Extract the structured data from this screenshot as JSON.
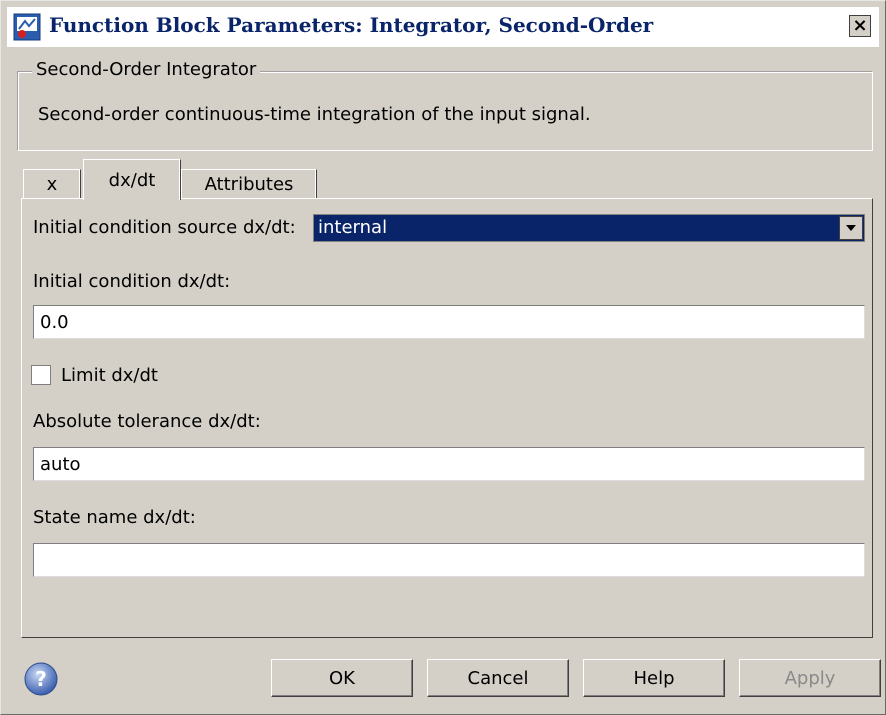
{
  "window": {
    "title": "Function Block Parameters: Integrator, Second-Order",
    "close_label": "×"
  },
  "group": {
    "legend": "Second-Order Integrator",
    "description": "Second-order continuous-time integration of the input signal."
  },
  "tabs": [
    {
      "label": "x",
      "active": false
    },
    {
      "label": "dx/dt",
      "active": true
    },
    {
      "label": "Attributes",
      "active": false
    }
  ],
  "fields": {
    "ic_source_label": "Initial condition source dx/dt:",
    "ic_source_value": "internal",
    "ic_label": "Initial condition dx/dt:",
    "ic_value": "0.0",
    "limit_label": "Limit dx/dt",
    "limit_checked": false,
    "abs_tol_label": "Absolute tolerance dx/dt:",
    "abs_tol_value": "auto",
    "state_name_label": "State name dx/dt:",
    "state_name_value": ""
  },
  "buttons": {
    "ok": "OK",
    "cancel": "Cancel",
    "help": "Help",
    "apply": "Apply"
  },
  "colors": {
    "title_text": "#0a246a",
    "select_highlight": "#0a246a",
    "help_icon": "#4a6fc0"
  }
}
